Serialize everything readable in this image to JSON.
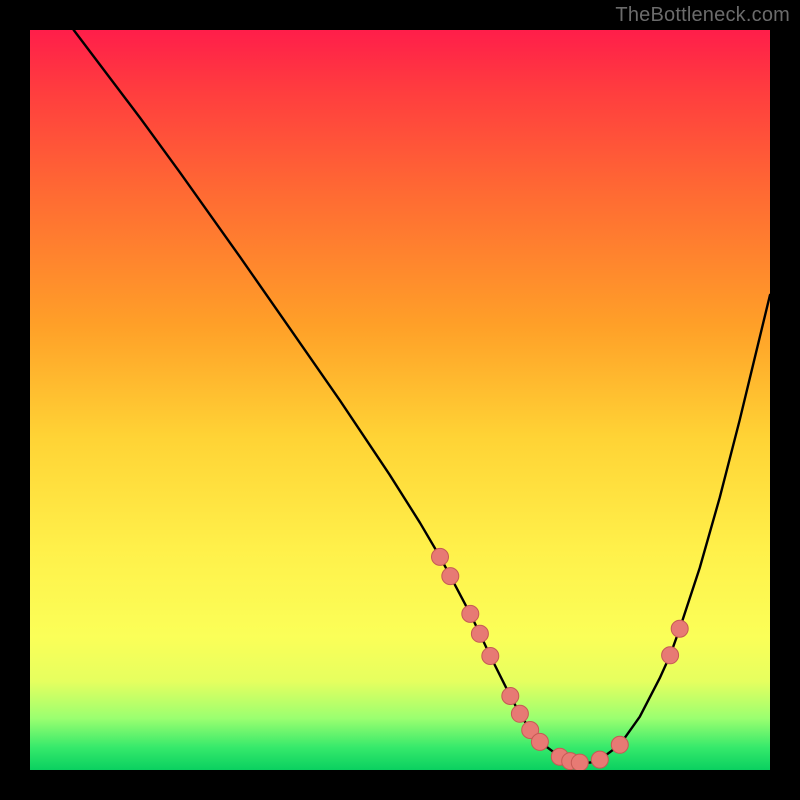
{
  "attribution": "TheBottleneck.com",
  "colors": {
    "marker_fill": "#e77a74",
    "marker_stroke": "#c65a55",
    "curve": "#000000"
  },
  "chart_data": {
    "type": "line",
    "title": "",
    "xlabel": "",
    "ylabel": "",
    "xlim": [
      0,
      100
    ],
    "ylim": [
      0,
      100
    ],
    "grid": false,
    "legend": false,
    "note": "Values estimated from pixel positions on a 0–100 normalized axis derived from the 740×740 plot area. y=0 is the bottom (green), y=100 is the top (red).",
    "curve_points": [
      {
        "x": 5.9,
        "y": 100.0
      },
      {
        "x": 14.9,
        "y": 88.1
      },
      {
        "x": 20.3,
        "y": 80.7
      },
      {
        "x": 28.4,
        "y": 69.3
      },
      {
        "x": 35.1,
        "y": 59.7
      },
      {
        "x": 41.9,
        "y": 49.9
      },
      {
        "x": 48.6,
        "y": 39.9
      },
      {
        "x": 52.7,
        "y": 33.4
      },
      {
        "x": 55.4,
        "y": 28.8
      },
      {
        "x": 56.8,
        "y": 26.2
      },
      {
        "x": 59.5,
        "y": 21.1
      },
      {
        "x": 60.8,
        "y": 18.4
      },
      {
        "x": 62.2,
        "y": 15.4
      },
      {
        "x": 64.9,
        "y": 10.0
      },
      {
        "x": 66.2,
        "y": 7.6
      },
      {
        "x": 67.6,
        "y": 5.4
      },
      {
        "x": 68.9,
        "y": 3.8
      },
      {
        "x": 71.6,
        "y": 1.8
      },
      {
        "x": 73.0,
        "y": 1.2
      },
      {
        "x": 74.3,
        "y": 1.0
      },
      {
        "x": 75.7,
        "y": 1.0
      },
      {
        "x": 77.0,
        "y": 1.4
      },
      {
        "x": 79.7,
        "y": 3.4
      },
      {
        "x": 82.4,
        "y": 7.2
      },
      {
        "x": 85.1,
        "y": 12.4
      },
      {
        "x": 86.5,
        "y": 15.5
      },
      {
        "x": 87.8,
        "y": 19.1
      },
      {
        "x": 90.5,
        "y": 27.3
      },
      {
        "x": 93.2,
        "y": 36.8
      },
      {
        "x": 95.9,
        "y": 47.3
      },
      {
        "x": 100.0,
        "y": 64.2
      }
    ],
    "series": [
      {
        "name": "markers",
        "points": [
          {
            "x": 55.4,
            "y": 28.8
          },
          {
            "x": 56.8,
            "y": 26.2
          },
          {
            "x": 59.5,
            "y": 21.1
          },
          {
            "x": 60.8,
            "y": 18.4
          },
          {
            "x": 62.2,
            "y": 15.4
          },
          {
            "x": 64.9,
            "y": 10.0
          },
          {
            "x": 66.2,
            "y": 7.6
          },
          {
            "x": 67.6,
            "y": 5.4
          },
          {
            "x": 68.9,
            "y": 3.8
          },
          {
            "x": 71.6,
            "y": 1.8
          },
          {
            "x": 73.0,
            "y": 1.2
          },
          {
            "x": 74.3,
            "y": 1.0
          },
          {
            "x": 77.0,
            "y": 1.4
          },
          {
            "x": 79.7,
            "y": 3.4
          },
          {
            "x": 86.5,
            "y": 15.5
          },
          {
            "x": 87.8,
            "y": 19.1
          }
        ]
      }
    ]
  }
}
